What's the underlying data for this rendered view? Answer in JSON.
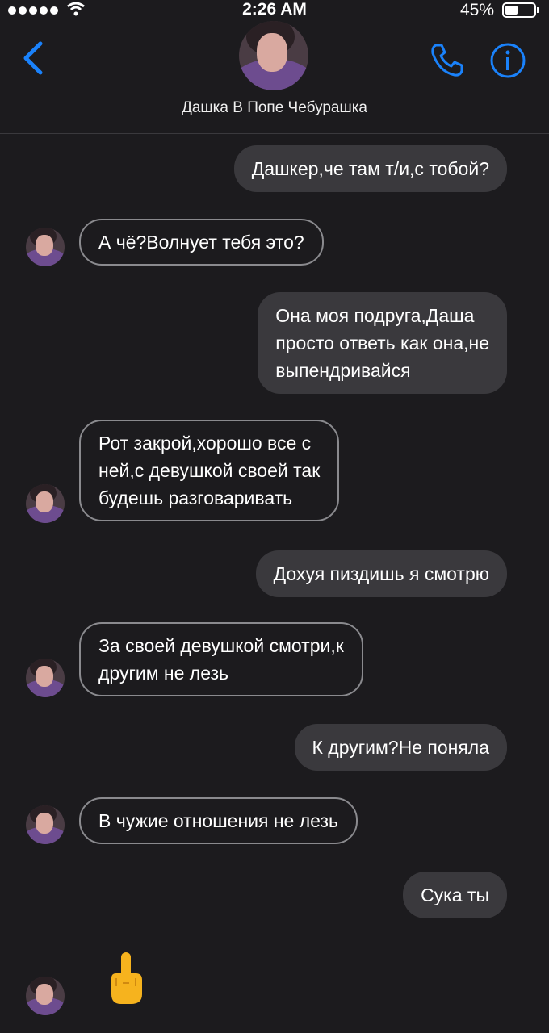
{
  "status_bar": {
    "time": "2:26 AM",
    "battery": "45%"
  },
  "header": {
    "contact_name": "Дашка В Попе Чебурашка",
    "accent_color": "#1a82fb"
  },
  "messages": [
    {
      "direction": "out",
      "text": "Дашкер,че там т/и,с тобой?"
    },
    {
      "direction": "in",
      "text": "А чё?Волнует тебя это?"
    },
    {
      "direction": "out",
      "text": "Она моя подруга,Даша\nпросто ответь как она,не\nвыпендривайся"
    },
    {
      "direction": "in",
      "text": "Рот закрой,хорошо все с\nней,с девушкой своей так\nбудешь разговаривать"
    },
    {
      "direction": "out",
      "text": "Дохуя пиздишь я смотрю"
    },
    {
      "direction": "in",
      "text": "За своей девушкой смотри,к\nдругим не лезь"
    },
    {
      "direction": "out",
      "text": "К другим?Не поняла"
    },
    {
      "direction": "in",
      "text": "В чужие отношения не лезь"
    },
    {
      "direction": "out",
      "text": "Сука ты"
    },
    {
      "direction": "in",
      "emoji": "middle-finger-emoji"
    }
  ]
}
